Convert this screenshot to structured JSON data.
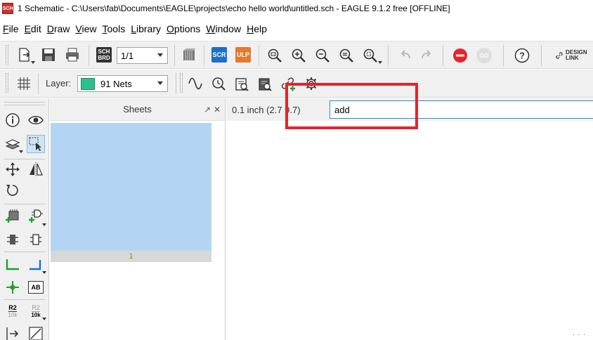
{
  "window": {
    "title": "1 Schematic - C:\\Users\\fab\\Documents\\EAGLE\\projects\\echo hello world\\untitled.sch - EAGLE 9.1.2 free [OFFLINE]",
    "app_icon_text": "SCH"
  },
  "menu": [
    {
      "label": "File"
    },
    {
      "label": "Edit"
    },
    {
      "label": "Draw"
    },
    {
      "label": "View"
    },
    {
      "label": "Tools"
    },
    {
      "label": "Library"
    },
    {
      "label": "Options"
    },
    {
      "label": "Window"
    },
    {
      "label": "Help"
    }
  ],
  "toolbar": {
    "sheet_select_value": "1/1",
    "sch_brd_top": "SCH",
    "sch_brd_bottom": "BRD",
    "scr_label": "SCR",
    "ulp_label": "ULP",
    "go_label": "GO",
    "design_link_line1": "DESIGN",
    "design_link_line2": "LINK",
    "layer_label": "Layer:",
    "layer_value": "91 Nets",
    "layer_color": "#2fbf8f"
  },
  "left_toolbar": {
    "r2_label": "R2",
    "value_label": "10k",
    "ab_label": "AB"
  },
  "sheets_panel": {
    "title": "Sheets",
    "sheet_number": "1"
  },
  "command_bar": {
    "grid_readout": "0.1 inch (2.7 9.7)",
    "command_value": "add"
  },
  "colors": {
    "accent_blue": "#1a70c8",
    "stop_red": "#e3242b",
    "sheet_blue": "#b3d5f3",
    "highlight_red": "#e3242b"
  }
}
